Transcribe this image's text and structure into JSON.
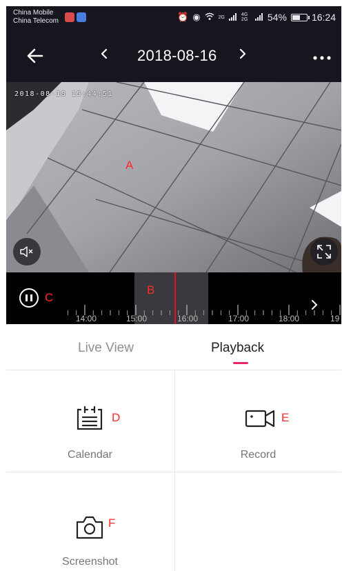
{
  "status_bar": {
    "carrier_1": "China Mobile",
    "carrier_2": "China Telecom",
    "network_1": "2G",
    "network_2": "4G 2G",
    "battery_percent": "54%",
    "battery_level": 0.54,
    "time": "16:24"
  },
  "header": {
    "back_icon": "back-arrow-icon",
    "prev_icon": "chevron-left-icon",
    "date": "2018-08-16",
    "next_icon": "chevron-right-icon",
    "more_icon": "more-icon"
  },
  "video": {
    "osd_timestamp": "2018-08-18 15:44:51",
    "marker_a": "A"
  },
  "timeline": {
    "marker_b": "B",
    "marker_c": "C",
    "tick_labels": [
      "14:00",
      "15:00",
      "16:00",
      "17:00",
      "18:00",
      "19"
    ]
  },
  "tabs": {
    "live_view": "Live View",
    "playback": "Playback",
    "accent_color": "#e8256a"
  },
  "actions": {
    "calendar": {
      "label": "Calendar",
      "marker": "D",
      "icon": "calendar-icon"
    },
    "record": {
      "label": "Record",
      "marker": "E",
      "icon": "video-camera-icon"
    },
    "screenshot": {
      "label": "Screenshot",
      "marker": "F",
      "icon": "camera-icon"
    }
  }
}
